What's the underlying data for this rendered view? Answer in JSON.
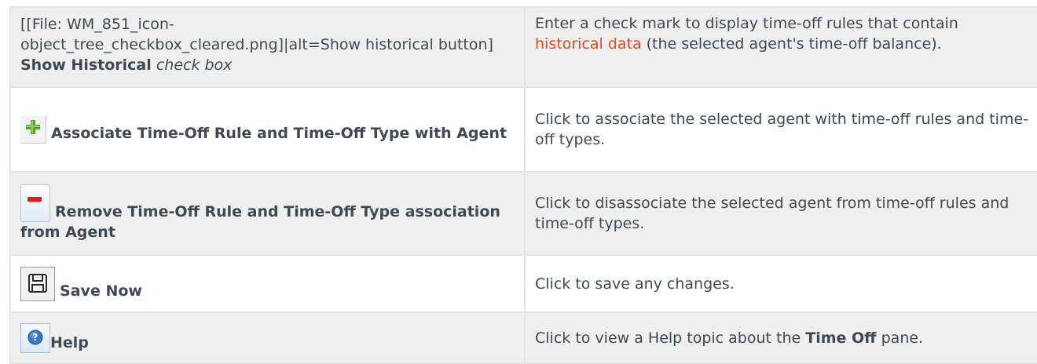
{
  "rows": [
    {
      "term_prefix": "[[File: WM_851_icon-object_tree_checkbox_cleared.png]|alt=Show historical button]",
      "term_label": "Show Historical",
      "term_suffix": "check box",
      "desc_before": "Enter a check mark to display time-off rules that contain",
      "desc_link": "historical data",
      "desc_after": "(the selected agent's time-off balance)."
    },
    {
      "icon": "plus-icon",
      "term_label": "Associate Time-Off Rule and Time-Off Type with Agent",
      "desc": "Click to associate the selected agent with time-off rules and time-off types."
    },
    {
      "icon": "minus-icon",
      "term_label": "Remove Time-Off Rule and Time-Off Type association from Agent",
      "desc": "Click to disassociate the selected agent from time-off rules and time-off types."
    },
    {
      "icon": "save-icon",
      "term_label": "Save Now",
      "desc": "Click to save any changes."
    },
    {
      "icon": "help-icon",
      "term_label": "Help",
      "desc_before": "Click to view a Help topic about the",
      "desc_bold": "Time Off",
      "desc_after": "pane."
    }
  ],
  "colors": {
    "text": "#3d4a56",
    "link": "#e8491d",
    "row_alt": "#efefef",
    "border": "#e2e4e7"
  }
}
